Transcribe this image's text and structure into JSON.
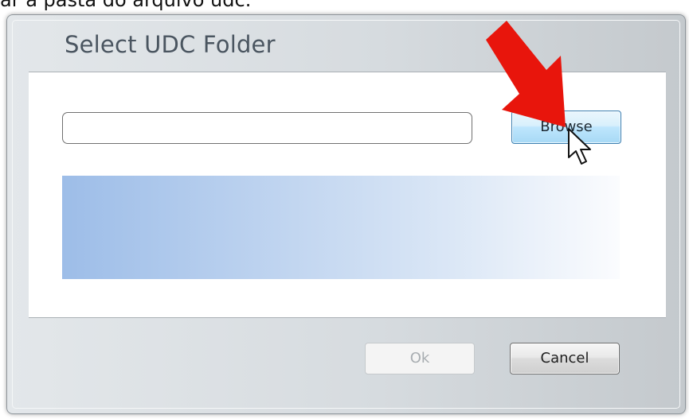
{
  "caption": "ar a pasta do arquivo udc.",
  "dialog": {
    "title": "Select UDC Folder",
    "path_input": {
      "value": "",
      "placeholder": ""
    },
    "browse_label": "Browse",
    "ok_label": "Ok",
    "cancel_label": "Cancel"
  },
  "annotation": {
    "arrow_icon": "red-arrow-icon",
    "arrow_color": "#e8150c",
    "cursor_icon": "mouse-cursor-icon"
  },
  "colors": {
    "browse_button": "#bee6fd",
    "progress_start": "#9dbde8",
    "progress_end": "#fbfcfe"
  }
}
